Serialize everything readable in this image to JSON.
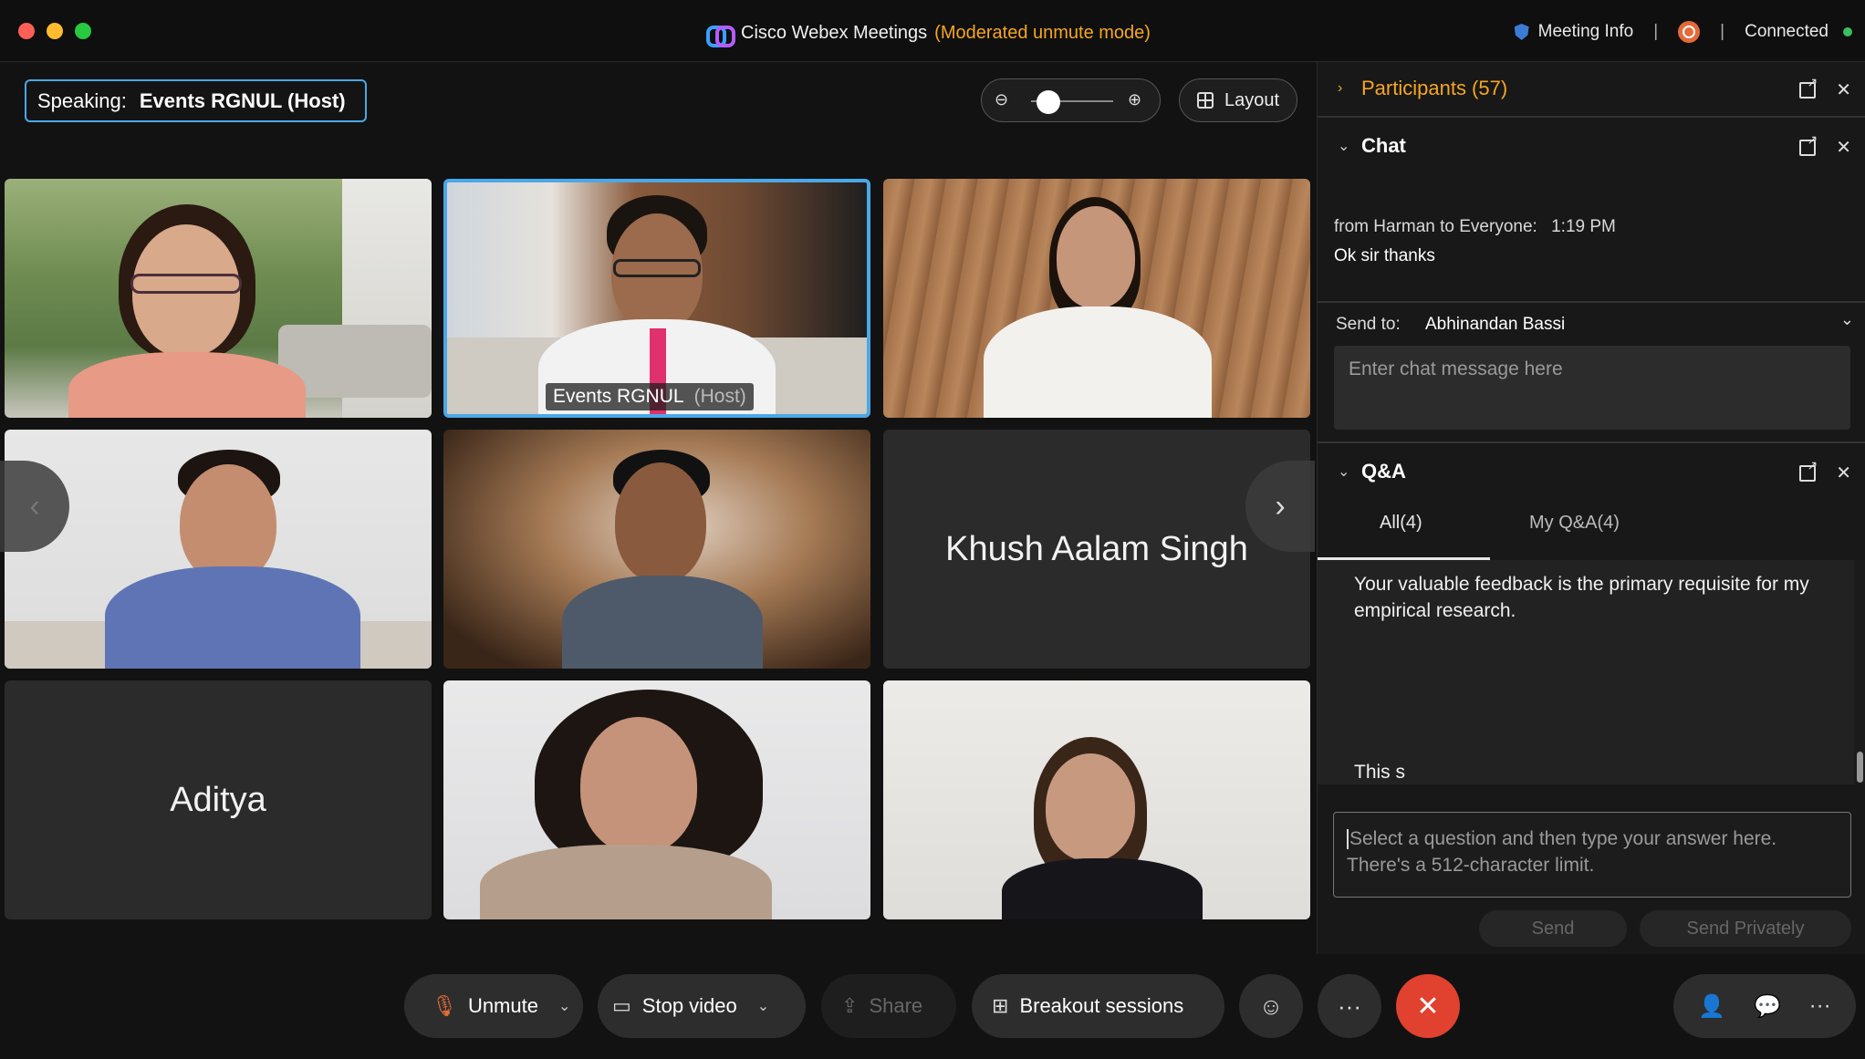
{
  "window": {
    "app_title": "Cisco Webex Meetings",
    "mode": "(Moderated unmute mode)",
    "meeting_info": "Meeting Info",
    "separator": "|",
    "connection": "Connected"
  },
  "stage": {
    "speaking_label": "Speaking:",
    "speaking_name": "Events RGNUL (Host)",
    "zoom_level": 0.1,
    "layout_label": "Layout",
    "prev_glyph": "‹",
    "next_glyph": "›"
  },
  "tiles": [
    {
      "name": "",
      "type": "video"
    },
    {
      "name": "Events RGNUL",
      "host": "(Host)",
      "type": "video",
      "active": true
    },
    {
      "name": "",
      "type": "video"
    },
    {
      "name": "",
      "type": "video"
    },
    {
      "name": "",
      "type": "video"
    },
    {
      "name": "Khush Aalam Singh",
      "type": "name-only"
    },
    {
      "name": "Aditya",
      "type": "name-only"
    },
    {
      "name": "",
      "type": "video"
    },
    {
      "name": "",
      "type": "video"
    }
  ],
  "controls": {
    "unmute": "Unmute",
    "stop_video": "Stop video",
    "share": "Share",
    "breakout": "Breakout sessions",
    "more": "···",
    "end": "✕"
  },
  "panel": {
    "participants": {
      "title": "Participants (57)"
    },
    "chat": {
      "title": "Chat",
      "message_from": "from Harman to Everyone:",
      "message_time": "1:19  PM",
      "message_text": "Ok sir thanks",
      "send_to_label": "Send to:",
      "send_to_value": "Abhinandan Bassi",
      "input_placeholder": "Enter chat message here"
    },
    "qa": {
      "title": "Q&A",
      "tab_all": "All(4)",
      "tab_my": "My Q&A(4)",
      "items": [
        "Your valuable feedback is the primary requisite for my empirical research.",
        "This s"
      ],
      "answer_placeholder_line1": "Select a question and then type your answer here.",
      "answer_placeholder_line2": "There's a 512-character limit.",
      "send": "Send",
      "send_privately": "Send Privately"
    }
  },
  "colors": {
    "accent_blue": "#4aa8e8",
    "accent_orange": "#f5a623",
    "end_call_red": "#e0422f",
    "connected_green": "#3bbf60"
  }
}
